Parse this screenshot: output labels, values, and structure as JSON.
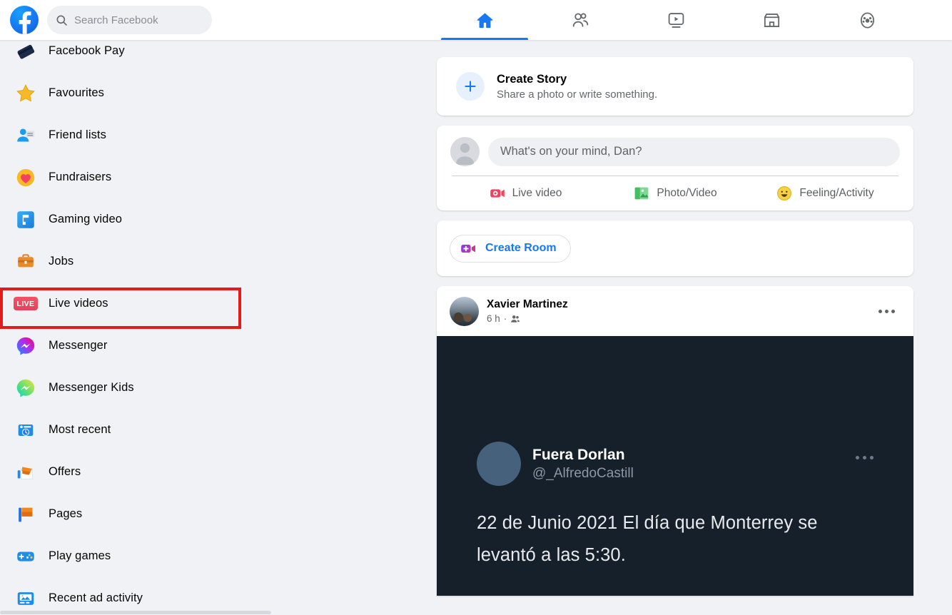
{
  "app": {
    "name": "Facebook",
    "logo_letter": "f",
    "brand_color": "#1877f2"
  },
  "topbar": {
    "search": {
      "placeholder": "Search Facebook",
      "value": "",
      "icon": "search-icon"
    },
    "nav": [
      {
        "id": "home",
        "icon": "home-icon",
        "label": "Home",
        "active": true
      },
      {
        "id": "friends",
        "icon": "friends-icon",
        "label": "Friends",
        "active": false
      },
      {
        "id": "watch",
        "icon": "watch-icon",
        "label": "Watch",
        "active": false
      },
      {
        "id": "marketplace",
        "icon": "marketplace-icon",
        "label": "Marketplace",
        "active": false
      },
      {
        "id": "groups",
        "icon": "groups-icon",
        "label": "Groups",
        "active": false
      }
    ]
  },
  "sidebar": {
    "items": [
      {
        "label": "Facebook Pay",
        "icon": "facebook-pay-icon"
      },
      {
        "label": "Favourites",
        "icon": "star-icon"
      },
      {
        "label": "Friend lists",
        "icon": "friend-lists-icon"
      },
      {
        "label": "Fundraisers",
        "icon": "heart-icon"
      },
      {
        "label": "Gaming video",
        "icon": "gaming-video-icon"
      },
      {
        "label": "Jobs",
        "icon": "briefcase-icon"
      },
      {
        "label": "Live videos",
        "icon": "live-badge-icon",
        "badge_text": "LIVE",
        "highlighted": true
      },
      {
        "label": "Messenger",
        "icon": "messenger-icon"
      },
      {
        "label": "Messenger Kids",
        "icon": "messenger-kids-icon"
      },
      {
        "label": "Most recent",
        "icon": "most-recent-icon"
      },
      {
        "label": "Offers",
        "icon": "offers-icon"
      },
      {
        "label": "Pages",
        "icon": "pages-icon"
      },
      {
        "label": "Play games",
        "icon": "play-games-icon"
      },
      {
        "label": "Recent ad activity",
        "icon": "recent-ad-activity-icon"
      }
    ],
    "highlight_color": "#e21b1b"
  },
  "feed": {
    "create_story": {
      "title": "Create Story",
      "subtitle": "Share a photo or write something.",
      "icon": "plus-icon"
    },
    "composer": {
      "placeholder": "What's on your mind, Dan?",
      "avatar": "user-avatar",
      "actions": [
        {
          "label": "Live video",
          "icon": "live-video-icon",
          "color": "#f3425f"
        },
        {
          "label": "Photo/Video",
          "icon": "photo-video-icon",
          "color": "#45bd62"
        },
        {
          "label": "Feeling/Activity",
          "icon": "feeling-activity-icon",
          "color": "#f7b928"
        }
      ]
    },
    "create_room": {
      "label": "Create Room",
      "icon": "create-room-icon"
    },
    "post": {
      "author": "Xavier Martinez",
      "time": "6 h",
      "audience_separator": "·",
      "audience_icon": "friends-audience-icon",
      "menu_icon": "more-options-icon",
      "embedded_tweet": {
        "display_name": "Fuera Dorlan",
        "handle": "@_AlfredoCastill",
        "text": "22 de Junio 2021 El día que Monterrey se levantó a las 5:30.",
        "menu_icon": "more-options-icon",
        "background_color": "#16202a"
      }
    }
  }
}
